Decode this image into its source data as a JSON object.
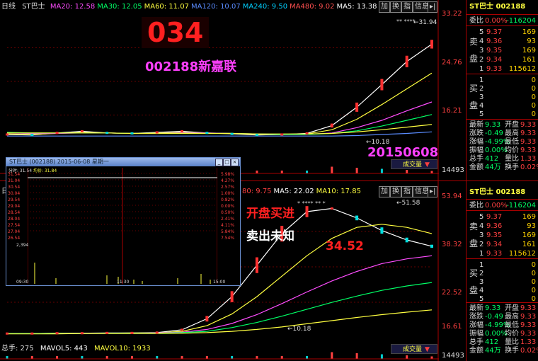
{
  "top": {
    "period": "日线",
    "stock": "ST巴士",
    "ma_items": [
      {
        "label": "MA20: 12.58",
        "color": "#ff4dff"
      },
      {
        "label": "MA30: 12.05",
        "color": "#00ff66"
      },
      {
        "label": "MA60: 11.07",
        "color": "#ffff40"
      },
      {
        "label": "MA120: 10.07",
        "color": "#5a8cff"
      },
      {
        "label": "MA240: 9.50",
        "color": "#00d0ff"
      },
      {
        "label": "MA480: 9.02",
        "color": "#ff5050"
      },
      {
        "label": "MA5: 13.38",
        "color": "#ffffff"
      },
      {
        "label": "MA10: 13.20",
        "color": "#ffff40"
      }
    ],
    "buttons": [
      "加",
      "换",
      "指",
      "信息",
      "▸|"
    ],
    "price_labels": [
      "33.22",
      "24.76",
      "16.21",
      "20.16"
    ],
    "annot_code": "034",
    "annot_name": "002188新嘉联",
    "annot_date": "20150608",
    "low_mark": "10.18",
    "high_mark": "31.94",
    "stars": "** ****",
    "volume_btn": "成交量",
    "vol_label": "14493"
  },
  "bottom": {
    "ma_items": [
      {
        "label": "80: 9.75",
        "color": "#ff4040"
      },
      {
        "label": "MA5: 22.02",
        "color": "#ffffff"
      },
      {
        "label": "MA10: 17.85",
        "color": "#ffff40"
      }
    ],
    "price_labels": [
      "53.94",
      "38.32",
      "22.52",
      "16.61"
    ],
    "annot_buy": "开盘买进",
    "annot_sell": "卖出未知",
    "annot_price": "34.52",
    "high_mark": "51.58",
    "low_mark": "10.18",
    "stars": "* **** ** *",
    "vol_bar_text": {
      "total": "总手: 275",
      "mavol5": "MAVOL5: 443",
      "mavol10": "MAVOL10: 1933"
    },
    "volume_btn": "成交量",
    "vol_label": "14493",
    "buttons": [
      "加",
      "换",
      "指",
      "信息",
      "▸|"
    ]
  },
  "order_book_top": {
    "title": "ST巴士 002188",
    "wei_bi": "委比",
    "wei_bi_val": "0.00%",
    "wei_cha": "-116204",
    "sell_rows": [
      {
        "lv": "5",
        "price": "9.37",
        "vol": "169"
      },
      {
        "lv": "4",
        "price": "9.36",
        "vol": "93"
      },
      {
        "lv": "3",
        "price": "9.35",
        "vol": "169"
      },
      {
        "lv": "2",
        "price": "9.34",
        "vol": "161"
      },
      {
        "lv": "1",
        "price": "9.33",
        "vol": "115612"
      }
    ],
    "buy_rows": [
      {
        "lv": "1",
        "vol": "0"
      },
      {
        "lv": "2",
        "vol": "0"
      },
      {
        "lv": "3",
        "vol": "0"
      },
      {
        "lv": "4",
        "vol": "0"
      },
      {
        "lv": "5",
        "vol": "0"
      }
    ],
    "sell_label": [
      "卖",
      "盘"
    ],
    "buy_label": [
      "买",
      "盘"
    ],
    "stats": [
      [
        "最新",
        "9.33",
        "开盘",
        "9.33"
      ],
      [
        "涨跌",
        "-0.49",
        "最高",
        "9.33"
      ],
      [
        "涨幅",
        "-4.99%",
        "最低",
        "9.33"
      ],
      [
        "振幅",
        "0.00%",
        "均价",
        "9.33"
      ],
      [
        "总手",
        "412",
        "量比",
        "1.33"
      ],
      [
        "金额",
        "44万",
        "换手",
        "0.02%"
      ]
    ]
  },
  "order_book_bottom": {
    "title": "ST巴士 002188",
    "wei_bi": "委比",
    "wei_bi_val": "0.00%",
    "wei_cha": "-116204",
    "sell_rows": [
      {
        "lv": "5",
        "price": "9.37",
        "vol": "169"
      },
      {
        "lv": "4",
        "price": "9.36",
        "vol": "93"
      },
      {
        "lv": "3",
        "price": "9.35",
        "vol": "169"
      },
      {
        "lv": "2",
        "price": "9.34",
        "vol": "161"
      },
      {
        "lv": "1",
        "price": "9.33",
        "vol": "115612"
      }
    ],
    "buy_rows": [
      {
        "lv": "1",
        "vol": "0"
      },
      {
        "lv": "2",
        "vol": "0"
      },
      {
        "lv": "3",
        "vol": "0"
      },
      {
        "lv": "4",
        "vol": "0"
      },
      {
        "lv": "5",
        "vol": "0"
      }
    ],
    "sell_label": [
      "卖",
      "盘"
    ],
    "buy_label": [
      "买",
      "盘"
    ],
    "stats": [
      [
        "最新",
        "9.33",
        "开盘",
        "9.33"
      ],
      [
        "涨跌",
        "-0.49",
        "最高",
        "9.33"
      ],
      [
        "涨幅",
        "-4.99%",
        "最低",
        "9.33"
      ],
      [
        "振幅",
        "0.00%",
        "均价",
        "9.33"
      ],
      [
        "总手",
        "412",
        "量比",
        "1.33"
      ],
      [
        "金额",
        "44万",
        "换手",
        "0.02%"
      ]
    ]
  },
  "popup": {
    "title": "ST巴士 (002188)  2015-06-08  星期一",
    "legend": [
      "分时: 31.54",
      "均价: 31.84"
    ],
    "left_prices": [
      "31.54",
      "31.04",
      "30.54",
      "30.04",
      "29.54",
      "29.04",
      "28.54",
      "28.04",
      "27.54",
      "27.04",
      "26.54"
    ],
    "right_pcts": [
      "5.98%",
      "4.27%",
      "2.57%",
      "1.00%",
      "0.82%",
      "0.00%",
      "0.50%",
      "2.41%",
      "4.11%",
      "5.84%",
      "7.54%"
    ],
    "time_labels": [
      "09:30",
      "11:30",
      "15:00"
    ],
    "vol_label": "2,394"
  },
  "chart_data": [
    {
      "type": "line",
      "title": "ST巴士 日线",
      "ylim": [
        7.6,
        33.22
      ],
      "y_ticks": [
        33.22,
        24.76,
        16.21
      ],
      "series": [
        {
          "name": "MA5",
          "color": "#ffffff",
          "values": [
            10.3,
            10.2,
            10.6,
            10.9,
            10.6,
            10.5,
            10.7,
            10.9,
            10.6,
            10.4,
            10.2,
            10.3,
            10.5,
            12.0,
            15.5,
            19.8,
            24.2,
            27.5
          ]
        },
        {
          "name": "MA10",
          "color": "#ffff40",
          "values": [
            10.4,
            10.3,
            10.5,
            10.7,
            10.6,
            10.5,
            10.6,
            10.7,
            10.6,
            10.5,
            10.3,
            10.3,
            10.4,
            11.2,
            13.2,
            16.0,
            19.0,
            22.0
          ]
        },
        {
          "name": "MA20",
          "color": "#ff4dff",
          "values": [
            10.6,
            10.5,
            10.5,
            10.6,
            10.6,
            10.5,
            10.5,
            10.6,
            10.6,
            10.5,
            10.4,
            10.3,
            10.3,
            10.6,
            11.6,
            13.0,
            14.8,
            16.5
          ]
        },
        {
          "name": "MA30",
          "color": "#00ff66",
          "values": [
            10.7,
            10.6,
            10.6,
            10.6,
            10.6,
            10.5,
            10.5,
            10.5,
            10.5,
            10.5,
            10.4,
            10.3,
            10.3,
            10.5,
            11.0,
            11.9,
            13.0,
            14.1
          ]
        },
        {
          "name": "MA60",
          "color": "#ffff40",
          "values": [
            10.6,
            10.6,
            10.6,
            10.6,
            10.6,
            10.5,
            10.5,
            10.5,
            10.5,
            10.5,
            10.4,
            10.4,
            10.4,
            10.5,
            10.8,
            11.2,
            11.7,
            12.2
          ]
        },
        {
          "name": "MA120",
          "color": "#5a8cff",
          "values": [
            10.0,
            10.0,
            10.0,
            10.0,
            10.0,
            10.0,
            10.0,
            10.0,
            10.0,
            10.0,
            10.0,
            10.0,
            10.0,
            10.0,
            10.1,
            10.3,
            10.5,
            10.8
          ]
        }
      ]
    },
    {
      "type": "line",
      "title": "ST巴士 日线 (续)",
      "ylim": [
        9.0,
        53.94
      ],
      "y_ticks": [
        53.94,
        38.32,
        22.52
      ],
      "series": [
        {
          "name": "MA5",
          "color": "#ffffff",
          "values": [
            10.3,
            10.3,
            10.4,
            10.4,
            10.5,
            10.5,
            10.6,
            11.5,
            15.0,
            22.0,
            32.0,
            42.0,
            49.0,
            50.0,
            47.0,
            43.0,
            40.0,
            38.0
          ]
        },
        {
          "name": "MA10",
          "color": "#ffff40",
          "values": [
            10.3,
            10.3,
            10.4,
            10.4,
            10.4,
            10.5,
            10.5,
            11.0,
            12.8,
            16.5,
            22.0,
            28.5,
            35.0,
            40.5,
            44.0,
            45.0,
            44.0,
            42.0
          ]
        },
        {
          "name": "MA20",
          "color": "#ff4dff",
          "values": [
            10.3,
            10.3,
            10.3,
            10.4,
            10.4,
            10.4,
            10.5,
            10.7,
            11.6,
            13.5,
            16.3,
            19.8,
            23.5,
            27.0,
            30.0,
            32.5,
            34.0,
            35.0
          ]
        },
        {
          "name": "MA30",
          "color": "#00ff66",
          "values": [
            10.3,
            10.3,
            10.3,
            10.3,
            10.4,
            10.4,
            10.4,
            10.6,
            11.0,
            12.2,
            13.8,
            15.8,
            18.0,
            20.2,
            22.2,
            24.0,
            25.4,
            26.5
          ]
        },
        {
          "name": "MA60",
          "color": "#ffff40",
          "values": [
            10.2,
            10.2,
            10.2,
            10.3,
            10.3,
            10.3,
            10.3,
            10.4,
            10.6,
            11.0,
            11.6,
            12.4,
            13.4,
            14.4,
            15.4,
            16.3,
            17.1,
            17.8
          ]
        }
      ]
    }
  ]
}
